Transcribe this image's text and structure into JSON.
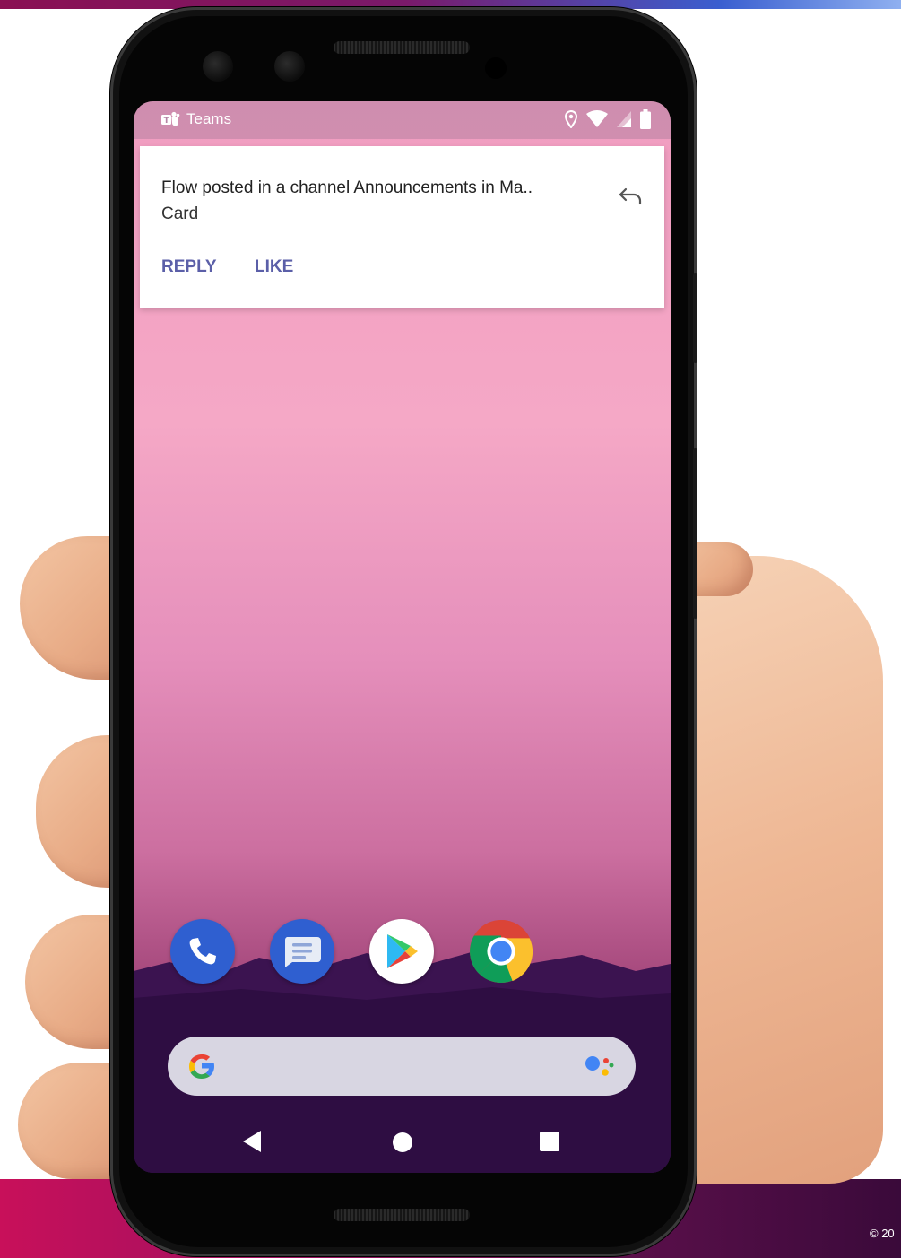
{
  "status_bar": {
    "app_name": "Teams"
  },
  "notification": {
    "title": "Flow posted in a channel Announcements in Ma..",
    "subtitle": "Card",
    "actions": [
      "REPLY",
      "LIKE"
    ]
  },
  "dock": {
    "apps": [
      "phone-icon",
      "messages-icon",
      "play-store-icon",
      "chrome-icon"
    ]
  },
  "footer": {
    "copyright": "© 20"
  },
  "colors": {
    "accent": "#5b5fa8",
    "brand_band": "#c8105a"
  }
}
